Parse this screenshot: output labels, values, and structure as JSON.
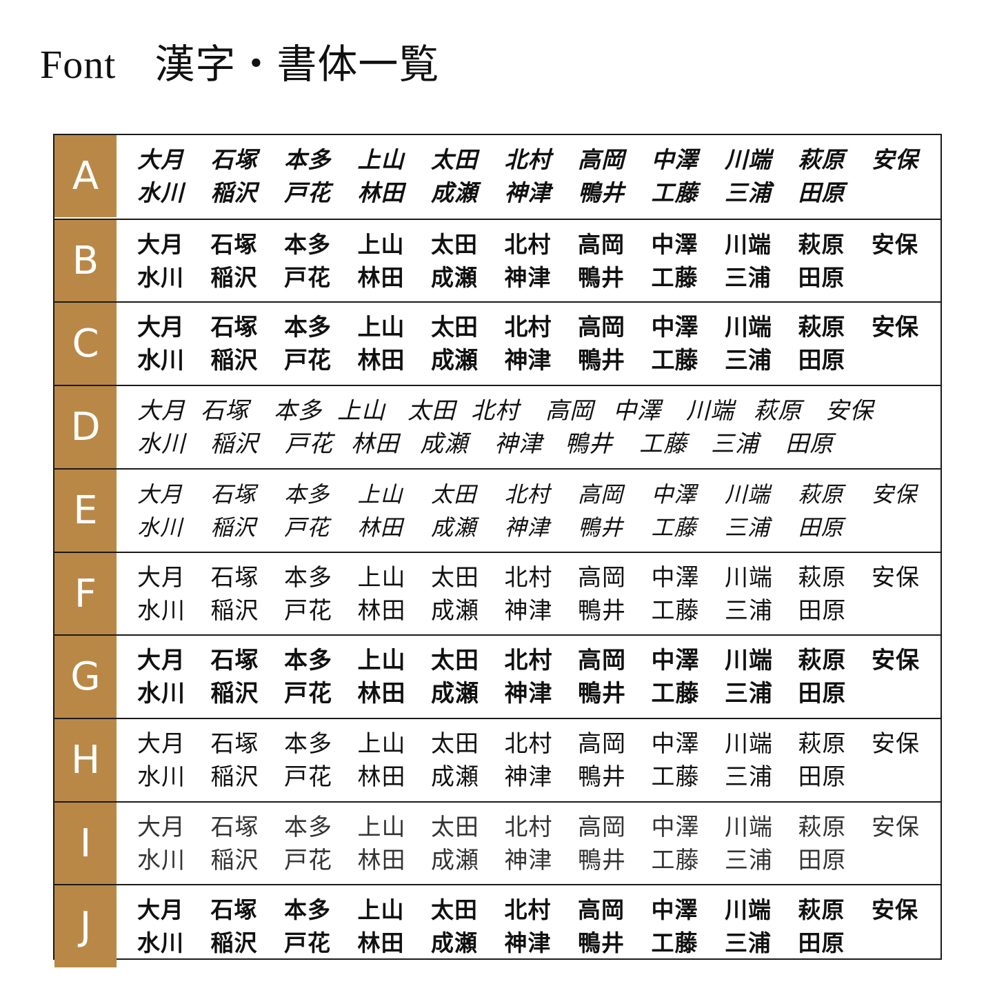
{
  "header": {
    "title_latin": "Font",
    "title_japanese": "漢字・書体一覧"
  },
  "colors": {
    "label_background": "#b98847",
    "label_text": "#ffffff",
    "border": "#1a1a1a",
    "text": "#111111"
  },
  "samples": {
    "line1": [
      "大月",
      "石塚",
      "本多",
      "上山",
      "太田",
      "北村",
      "高岡",
      "中澤",
      "川端",
      "萩原",
      "安保"
    ],
    "line2": [
      "水川",
      "稲沢",
      "戸花",
      "林田",
      "成瀬",
      "神津",
      "鴨井",
      "工藤",
      "三浦",
      "田原"
    ]
  },
  "rows": [
    {
      "label": "A"
    },
    {
      "label": "B"
    },
    {
      "label": "C"
    },
    {
      "label": "D"
    },
    {
      "label": "E"
    },
    {
      "label": "F"
    },
    {
      "label": "G"
    },
    {
      "label": "H"
    },
    {
      "label": "I"
    },
    {
      "label": "J"
    }
  ]
}
